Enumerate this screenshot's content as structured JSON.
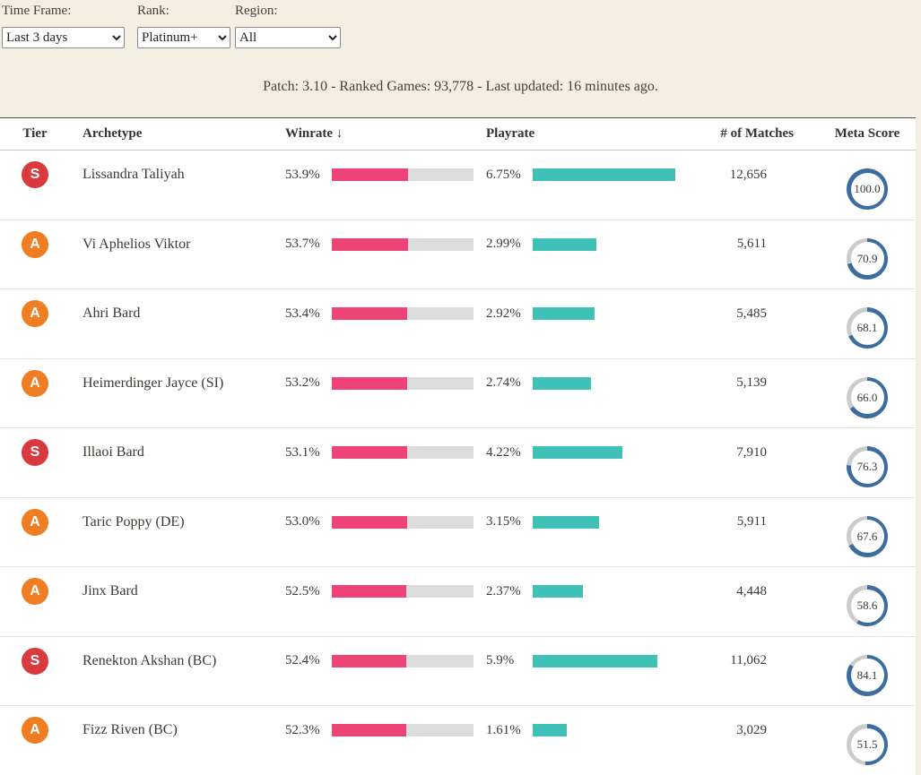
{
  "filters": {
    "time_frame": {
      "label": "Time Frame:",
      "value": "Last 3 days"
    },
    "rank": {
      "label": "Rank:",
      "value": "Platinum+"
    },
    "region": {
      "label": "Region:",
      "value": "All"
    }
  },
  "status_line": "Patch: 3.10 - Ranked Games: 93,778 - Last updated: 16 minutes ago.",
  "table": {
    "headers": {
      "tier": "Tier",
      "archetype": "Archetype",
      "winrate": "Winrate ↓",
      "playrate": "Playrate",
      "matches": "# of Matches",
      "meta_score": "Meta Score"
    },
    "rows": [
      {
        "tier": "S",
        "archetype": "Lissandra Taliyah",
        "winrate": "53.9%",
        "winrate_pct": 53.9,
        "playrate": "6.75%",
        "playrate_pct": 6.75,
        "matches": "12,656",
        "meta_score": "100.0",
        "meta_score_num": 100.0
      },
      {
        "tier": "A",
        "archetype": "Vi Aphelios Viktor",
        "winrate": "53.7%",
        "winrate_pct": 53.7,
        "playrate": "2.99%",
        "playrate_pct": 2.99,
        "matches": "5,611",
        "meta_score": "70.9",
        "meta_score_num": 70.9
      },
      {
        "tier": "A",
        "archetype": "Ahri Bard",
        "winrate": "53.4%",
        "winrate_pct": 53.4,
        "playrate": "2.92%",
        "playrate_pct": 2.92,
        "matches": "5,485",
        "meta_score": "68.1",
        "meta_score_num": 68.1
      },
      {
        "tier": "A",
        "archetype": "Heimerdinger Jayce (SI)",
        "winrate": "53.2%",
        "winrate_pct": 53.2,
        "playrate": "2.74%",
        "playrate_pct": 2.74,
        "matches": "5,139",
        "meta_score": "66.0",
        "meta_score_num": 66.0
      },
      {
        "tier": "S",
        "archetype": "Illaoi Bard",
        "winrate": "53.1%",
        "winrate_pct": 53.1,
        "playrate": "4.22%",
        "playrate_pct": 4.22,
        "matches": "7,910",
        "meta_score": "76.3",
        "meta_score_num": 76.3
      },
      {
        "tier": "A",
        "archetype": "Taric Poppy (DE)",
        "winrate": "53.0%",
        "winrate_pct": 53.0,
        "playrate": "3.15%",
        "playrate_pct": 3.15,
        "matches": "5,911",
        "meta_score": "67.6",
        "meta_score_num": 67.6
      },
      {
        "tier": "A",
        "archetype": "Jinx Bard",
        "winrate": "52.5%",
        "winrate_pct": 52.5,
        "playrate": "2.37%",
        "playrate_pct": 2.37,
        "matches": "4,448",
        "meta_score": "58.6",
        "meta_score_num": 58.6
      },
      {
        "tier": "S",
        "archetype": "Renekton Akshan (BC)",
        "winrate": "52.4%",
        "winrate_pct": 52.4,
        "playrate": "5.9%",
        "playrate_pct": 5.9,
        "matches": "11,062",
        "meta_score": "84.1",
        "meta_score_num": 84.1
      },
      {
        "tier": "A",
        "archetype": "Fizz Riven (BC)",
        "winrate": "52.3%",
        "winrate_pct": 52.3,
        "playrate": "1.61%",
        "playrate_pct": 1.61,
        "matches": "3,029",
        "meta_score": "51.5",
        "meta_score_num": 51.5
      }
    ]
  },
  "colors": {
    "page_background": "#f4efe3",
    "tier_colors": {
      "S": "#d83a3e",
      "A": "#ef7d22"
    },
    "winrate_bar": "#ee4377",
    "bar_track": "#dcdcdc",
    "playrate_bar": "#3fc1b8",
    "meta_ring": "#3d6d9e",
    "meta_ring_track": "#cccccc"
  }
}
